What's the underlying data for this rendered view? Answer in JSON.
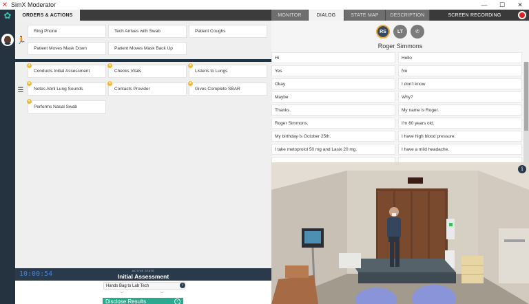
{
  "window": {
    "title": "SimX Moderator",
    "controls": [
      "—",
      "☐",
      "✕"
    ]
  },
  "left_nav": {
    "orders_tab": "ORDERS & ACTIONS"
  },
  "right_nav": {
    "tabs": [
      {
        "label": "MONITOR",
        "active": false
      },
      {
        "label": "DIALOG",
        "active": true
      },
      {
        "label": "STATE MAP",
        "active": false
      },
      {
        "label": "DESCRIPTION",
        "active": false
      }
    ],
    "screen_recording": "SCREEN RECORDING"
  },
  "actions": [
    "Ring Phone",
    "Tech Arrives with Swab",
    "Patient Coughs",
    "Patient Moves Mask Down",
    "Patient Moves Mask Back Up"
  ],
  "checklist": [
    "Conducts Initial Assessment",
    "Checks Vitals",
    "Listens to Lungs",
    "Notes Abnl Lung Sounds",
    "Contacts Provider",
    "Gives Complete SBAR",
    "Performs Nasal Swab"
  ],
  "state": {
    "timer": "10:00:54",
    "active_label": "ACTIVE STATE",
    "active_value": "Initial Assessment",
    "dropdown_value": "Hands Bag to Lab Tech",
    "disclose": "Disclose Results"
  },
  "dialog": {
    "participants": [
      {
        "initials": "RS",
        "active": true
      },
      {
        "initials": "LT",
        "active": false
      },
      {
        "initials": "✆",
        "active": false
      }
    ],
    "patient_name": "Roger Simmons",
    "lines_left": [
      "Hi",
      "Yes",
      "Okay",
      "Maybe",
      "Thanks.",
      "Roger Simmons.",
      "My birthday is October 25th.",
      "I take metoprolol 50 mg and Lasix 20 mg."
    ],
    "lines_right": [
      "Hello",
      "No",
      "I don't know",
      "Why?",
      "My name is Roger.",
      "I'm 60 years old.",
      "I have high blood pressure.",
      "I have a mild headache."
    ]
  },
  "colors": {
    "accent_teal": "#2aa98e",
    "rail": "#25323f",
    "badge": "#f1b72c",
    "record": "#e01e1e"
  }
}
